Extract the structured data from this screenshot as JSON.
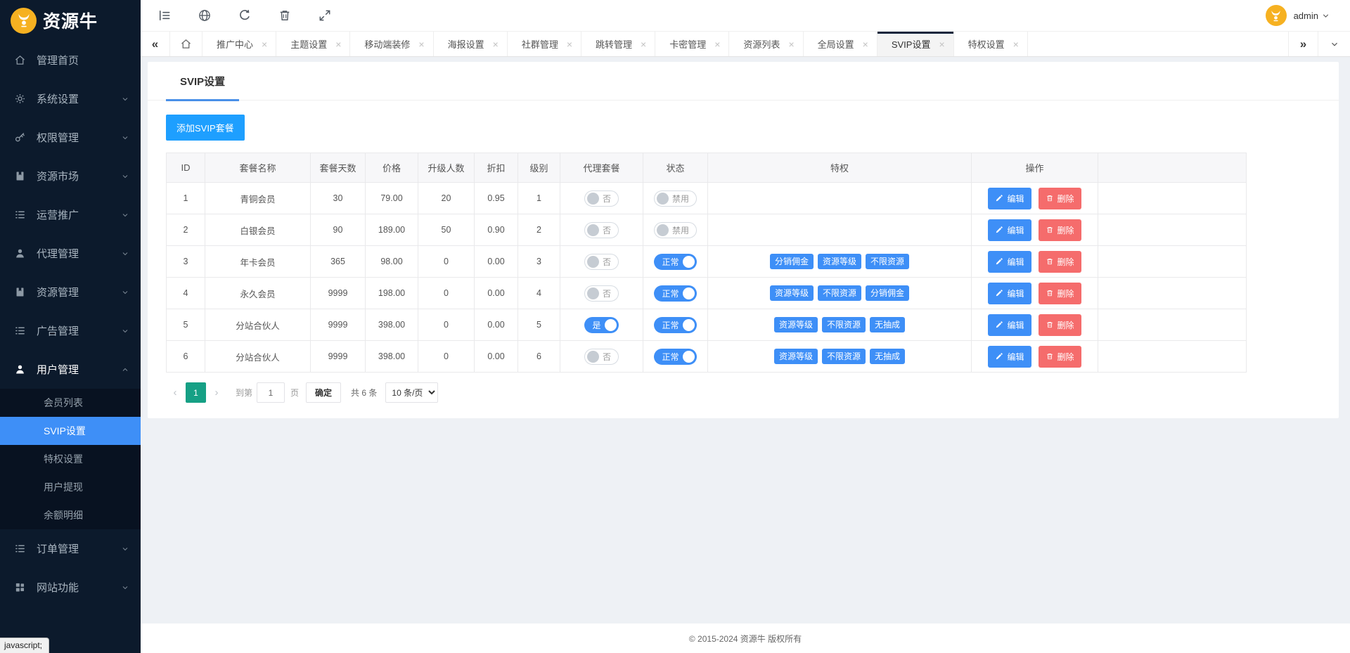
{
  "brand": {
    "name": "资源牛"
  },
  "topbar": {
    "icons": [
      "collapse-sidebar-icon",
      "globe-icon",
      "refresh-icon",
      "trash-icon",
      "fullscreen-icon"
    ],
    "user": {
      "name": "admin"
    }
  },
  "tabbar": {
    "tabs": [
      {
        "label": "推广中心",
        "active": false
      },
      {
        "label": "主题设置",
        "active": false
      },
      {
        "label": "移动端装修",
        "active": false
      },
      {
        "label": "海报设置",
        "active": false
      },
      {
        "label": "社群管理",
        "active": false
      },
      {
        "label": "跳转管理",
        "active": false
      },
      {
        "label": "卡密管理",
        "active": false
      },
      {
        "label": "资源列表",
        "active": false
      },
      {
        "label": "全局设置",
        "active": false
      },
      {
        "label": "SVIP设置",
        "active": true
      },
      {
        "label": "特权设置",
        "active": false
      }
    ]
  },
  "sidebar": {
    "items": [
      {
        "label": "管理首页",
        "icon": "home-icon",
        "arrow": "none"
      },
      {
        "label": "系统设置",
        "icon": "gear-icon",
        "arrow": "down"
      },
      {
        "label": "权限管理",
        "icon": "key-icon",
        "arrow": "down"
      },
      {
        "label": "资源市场",
        "icon": "book-icon",
        "arrow": "down"
      },
      {
        "label": "运营推广",
        "icon": "list-icon",
        "arrow": "down"
      },
      {
        "label": "代理管理",
        "icon": "user-icon",
        "arrow": "down"
      },
      {
        "label": "资源管理",
        "icon": "book-icon",
        "arrow": "down"
      },
      {
        "label": "广告管理",
        "icon": "list-icon",
        "arrow": "down"
      },
      {
        "label": "用户管理",
        "icon": "user-icon",
        "arrow": "up",
        "expanded": true,
        "children": [
          {
            "label": "会员列表",
            "active": false
          },
          {
            "label": "SVIP设置",
            "active": true
          },
          {
            "label": "特权设置",
            "active": false
          },
          {
            "label": "用户提现",
            "active": false
          },
          {
            "label": "余额明细",
            "active": false
          }
        ]
      },
      {
        "label": "订单管理",
        "icon": "list-icon",
        "arrow": "down"
      },
      {
        "label": "网站功能",
        "icon": "grid-icon",
        "arrow": "down"
      }
    ]
  },
  "page": {
    "title": "SVIP设置",
    "add_button": "添加SVIP套餐"
  },
  "table": {
    "headers": [
      "ID",
      "套餐名称",
      "套餐天数",
      "价格",
      "升级人数",
      "折扣",
      "级别",
      "代理套餐",
      "状态",
      "特权",
      "操作"
    ],
    "action_labels": {
      "edit": "编辑",
      "delete": "删除"
    },
    "rows": [
      {
        "id": "1",
        "name": "青铜会员",
        "days": "30",
        "price": "79.00",
        "upgrades": "20",
        "discount": "0.95",
        "level": "1",
        "agent_package": {
          "on": false,
          "label": "否"
        },
        "status": {
          "on": false,
          "label": "禁用"
        },
        "privileges": []
      },
      {
        "id": "2",
        "name": "白银会员",
        "days": "90",
        "price": "189.00",
        "upgrades": "50",
        "discount": "0.90",
        "level": "2",
        "agent_package": {
          "on": false,
          "label": "否"
        },
        "status": {
          "on": false,
          "label": "禁用"
        },
        "privileges": []
      },
      {
        "id": "3",
        "name": "年卡会员",
        "days": "365",
        "price": "98.00",
        "upgrades": "0",
        "discount": "0.00",
        "level": "3",
        "agent_package": {
          "on": false,
          "label": "否"
        },
        "status": {
          "on": true,
          "label": "正常"
        },
        "privileges": [
          "分销佣金",
          "资源等级",
          "不限资源"
        ]
      },
      {
        "id": "4",
        "name": "永久会员",
        "days": "9999",
        "price": "198.00",
        "upgrades": "0",
        "discount": "0.00",
        "level": "4",
        "agent_package": {
          "on": false,
          "label": "否"
        },
        "status": {
          "on": true,
          "label": "正常"
        },
        "privileges": [
          "资源等级",
          "不限资源",
          "分销佣金"
        ]
      },
      {
        "id": "5",
        "name": "分站合伙人",
        "days": "9999",
        "price": "398.00",
        "upgrades": "0",
        "discount": "0.00",
        "level": "5",
        "agent_package": {
          "on": true,
          "label": "是"
        },
        "status": {
          "on": true,
          "label": "正常"
        },
        "privileges": [
          "资源等级",
          "不限资源",
          "无抽成"
        ]
      },
      {
        "id": "6",
        "name": "分站合伙人",
        "days": "9999",
        "price": "398.00",
        "upgrades": "0",
        "discount": "0.00",
        "level": "6",
        "agent_package": {
          "on": false,
          "label": "否"
        },
        "status": {
          "on": true,
          "label": "正常"
        },
        "privileges": [
          "资源等级",
          "不限资源",
          "无抽成"
        ]
      }
    ]
  },
  "pagination": {
    "prev": "‹",
    "next": "›",
    "current_page": "1",
    "goto_label": "到第",
    "goto_value": "1",
    "page_label": "页",
    "confirm_label": "确定",
    "total_label": "共 6 条",
    "page_size": "10 条/页"
  },
  "footer": {
    "copyright": "© 2015-2024 资源牛 版权所有"
  },
  "status_bar": {
    "text": "javascript;"
  },
  "colors": {
    "accent_blue": "#3e8ff7",
    "button_blue": "#1e9fff",
    "danger_red": "#f56c6c",
    "pager_active_teal": "#16a085",
    "sidebar_bg": "#0c1a2c",
    "logo_yellow": "#f6b121"
  }
}
